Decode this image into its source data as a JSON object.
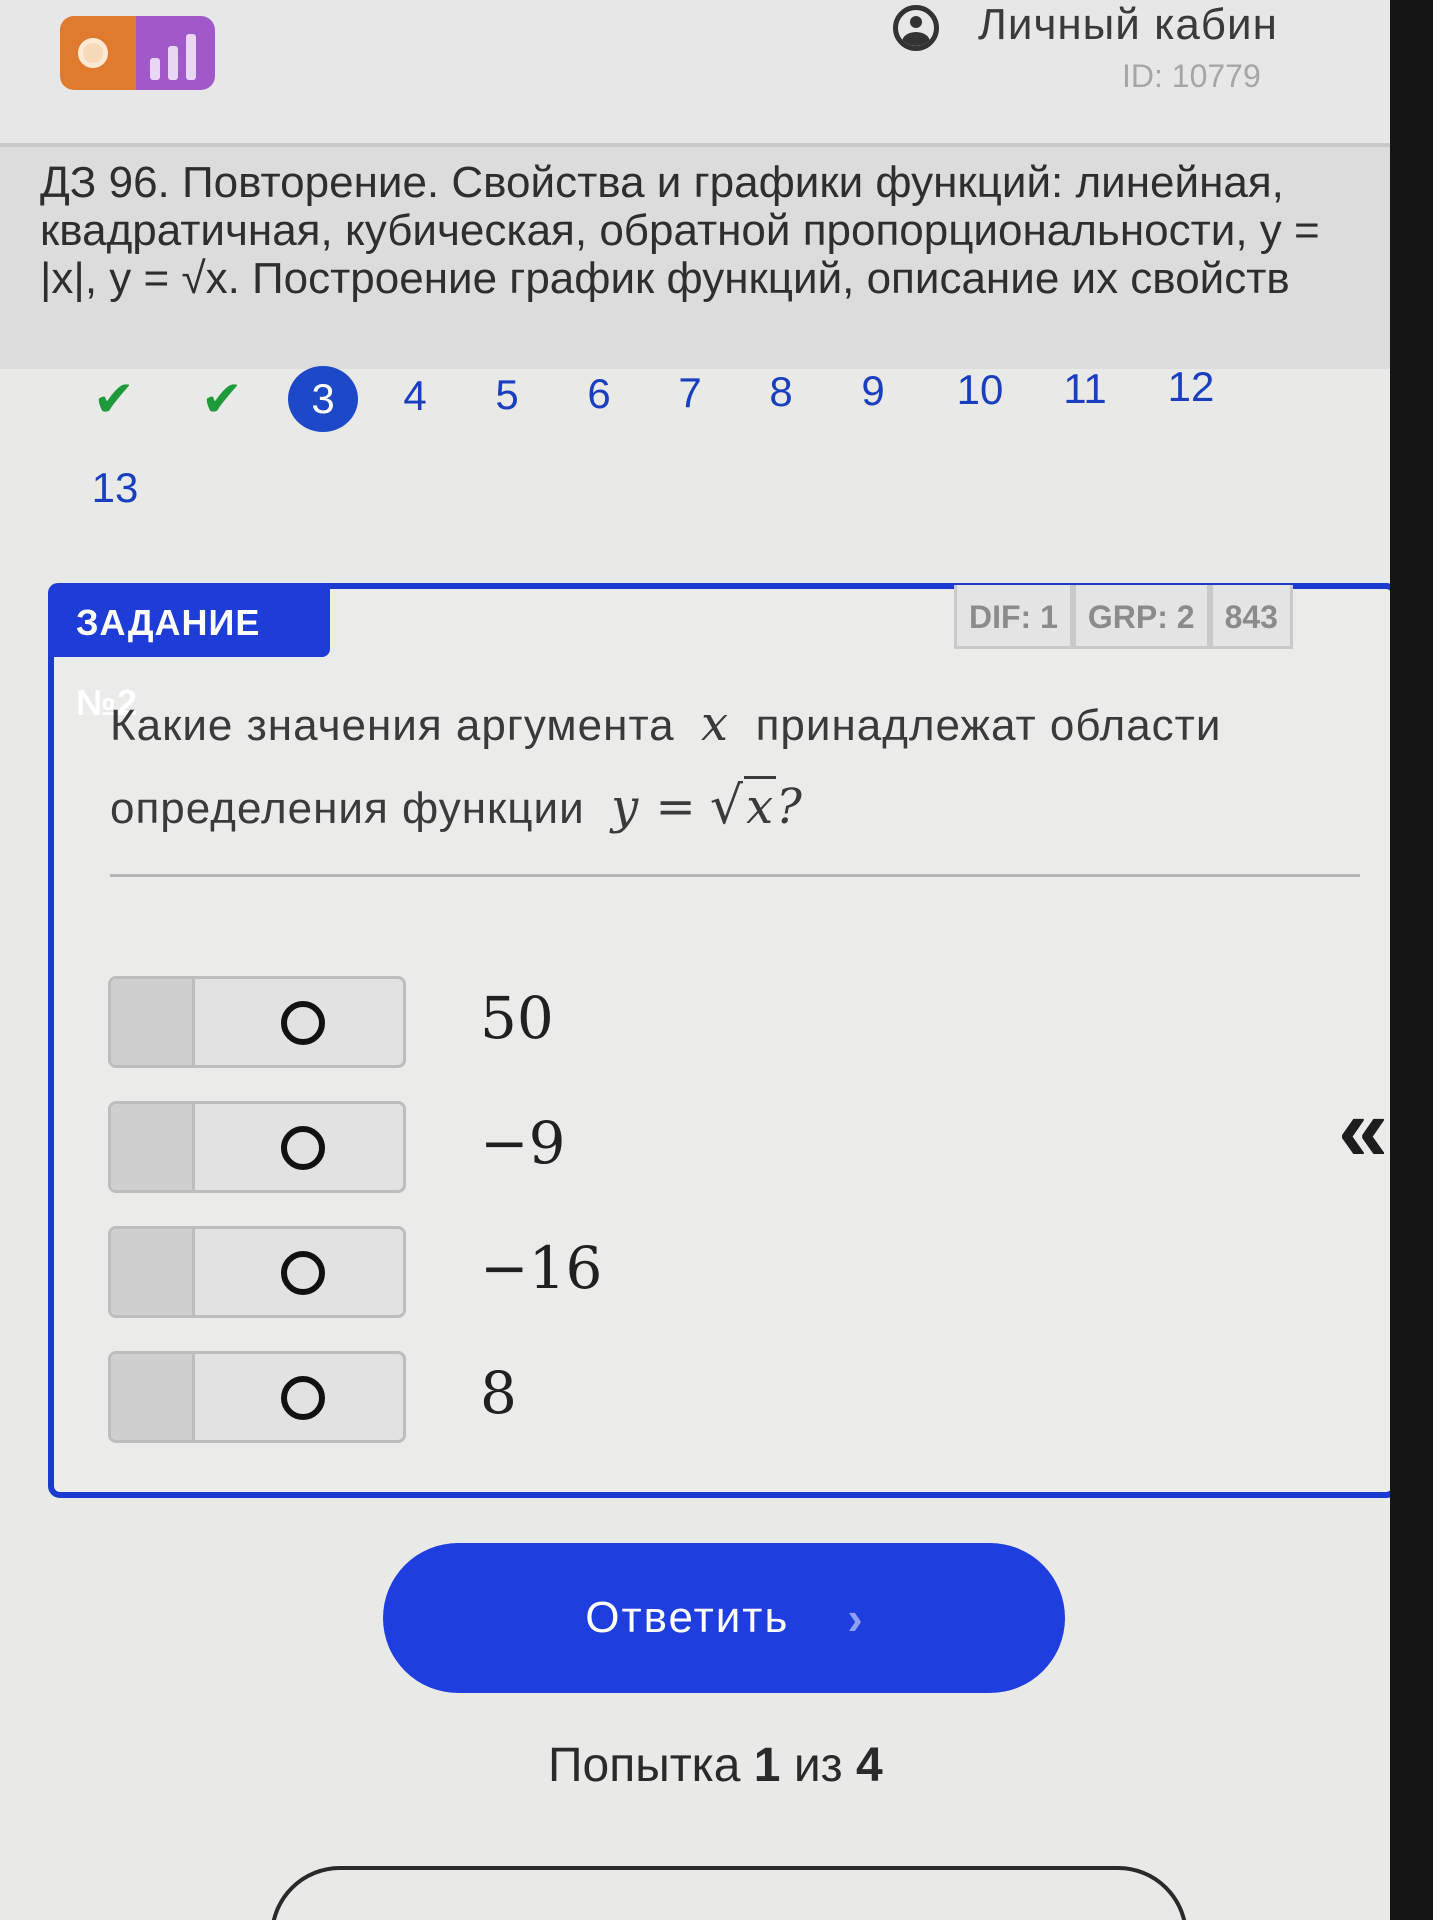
{
  "header": {
    "cabinet_label": "Личный кабин",
    "user_id": "ID: 10779"
  },
  "title": "ДЗ 96. Повторение. Свойства и графики функций: линейная, квадратичная, кубическая, обратной пропорциональности, y = |x|, y = √x. Построение график функций, описание их свойств",
  "tasknav": {
    "items": [
      {
        "label": "✔",
        "state": "done"
      },
      {
        "label": "✔",
        "state": "done"
      },
      {
        "label": "3",
        "state": "current"
      },
      {
        "label": "4",
        "state": "todo"
      },
      {
        "label": "5",
        "state": "todo"
      },
      {
        "label": "6",
        "state": "todo"
      },
      {
        "label": "7",
        "state": "todo"
      },
      {
        "label": "8",
        "state": "todo"
      },
      {
        "label": "9",
        "state": "todo"
      },
      {
        "label": "10",
        "state": "todo"
      },
      {
        "label": "11",
        "state": "todo"
      },
      {
        "label": "12",
        "state": "todo"
      },
      {
        "label": "13",
        "state": "todo"
      }
    ]
  },
  "task": {
    "badge": "ЗАДАНИЕ №2",
    "meta": [
      "DIF: 1",
      "GRP: 2",
      "843"
    ],
    "question_part1": "Какие значения аргумента",
    "question_var": "x",
    "question_part2": "принадлежат области",
    "question_part3": "определения функции",
    "question_func_lhs": "y =",
    "question_func_root": "√",
    "question_func_arg": "x",
    "question_end": "?",
    "options": [
      "50",
      "−9",
      "−16",
      "8"
    ]
  },
  "collapse_icon": "«",
  "submit": {
    "label": "Ответить",
    "chevron": "›"
  },
  "attempt": {
    "prefix": "Попытка",
    "current": "1",
    "middle": "из",
    "total": "4"
  },
  "colors": {
    "accent": "#1f3ee0",
    "check": "#1e9a3a",
    "nav_link": "#1a3fbe"
  }
}
